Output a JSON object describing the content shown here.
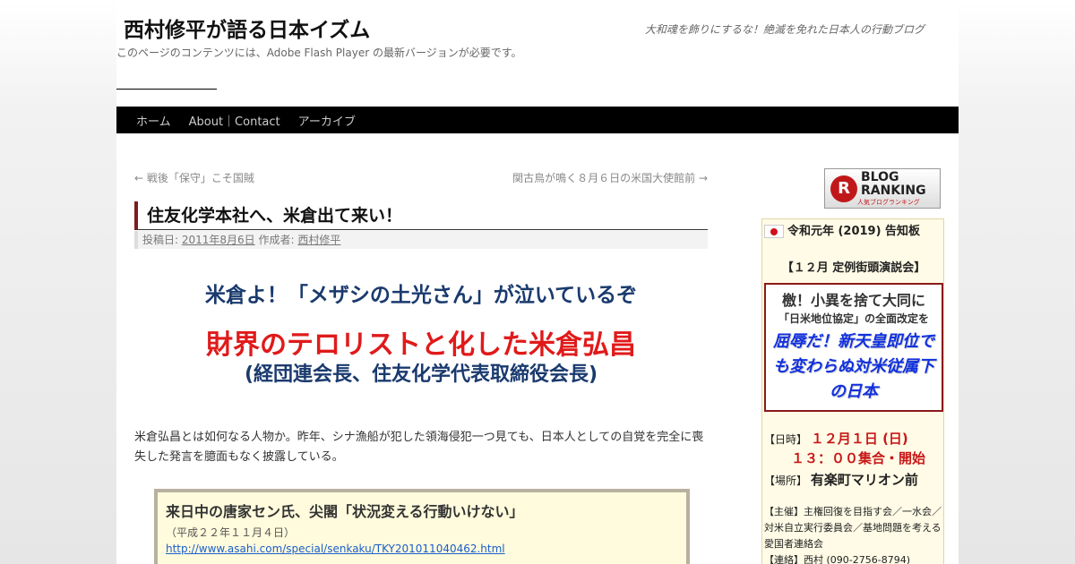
{
  "site": {
    "title": "西村修平が語る日本イズム",
    "description": "大和魂を飾りにするな！絶滅を免れた日本人の行動ブログ",
    "flash_note": "このページのコンテンツには、Adobe Flash Player の最新バージョンが必要です。"
  },
  "nav": {
    "items": [
      "ホーム",
      "About｜Contact",
      "アーカイブ"
    ]
  },
  "post_nav": {
    "prev": "← 戦後「保守」こそ国賊",
    "next": "関古鳥が鳴く８月６日の米国大使館前 →"
  },
  "post": {
    "title": "住友化学本社へ、米倉出て来い！",
    "meta_posted": "投稿日: ",
    "meta_date": "2011年8月6日",
    "meta_author_label": " 作成者: ",
    "meta_author": "西村修平",
    "headline1": "米倉よ！「メザシの土光さん」が泣いているぞ",
    "headline2": "財界のテロリストと化した米倉弘昌",
    "headline3": "(経団連会長、住友化学代表取締役会長)",
    "body": "米倉弘昌とは如何なる人物か。昨年、シナ漁船が犯した領海侵犯一つ見ても、日本人としての自覚を完全に喪失した発言を臆面もなく披露している。",
    "quote": {
      "title": "来日中の唐家セン氏、尖閣「状況変える行動いけない」",
      "date": "（平成２２年１１月４日）",
      "link": "http://www.asahi.com/special/senkaku/TKY201011040462.html"
    }
  },
  "sidebar": {
    "ranking": {
      "main": "BLOG",
      "main2": "RANKING",
      "sub": "人気ブログランキング"
    },
    "notice": "令和元年 (2019) 告知板",
    "event": "【１２月 定例街頭演説会】",
    "banner": {
      "line1": "檄！小異を捨て大同に",
      "line2": "「日米地位協定」の全面改定を",
      "line3": "屈辱だ！新天皇即位でも変わらぬ対米従属下の日本"
    },
    "date_label": "【日時】",
    "date_value": "１２月１日 (日)",
    "time_value": "１３：００集合・開始",
    "place_label": "【場所】",
    "place_value": "有楽町マリオン前",
    "organizer": "【主催】主権回復を目指す会／一水会／対米自立実行委員会／基地問題を考える愛国者連絡会",
    "contact": "【連絡】西村 (090-2756-8794)"
  },
  "colors": {
    "nav_bg": "#000000",
    "title_accent": "#7a1e1e",
    "headline_blue": "#1a3a6e",
    "headline_red": "#e01a1a",
    "banner_blue": "#1030e0",
    "sidebar_bg": "#fffbe6"
  }
}
